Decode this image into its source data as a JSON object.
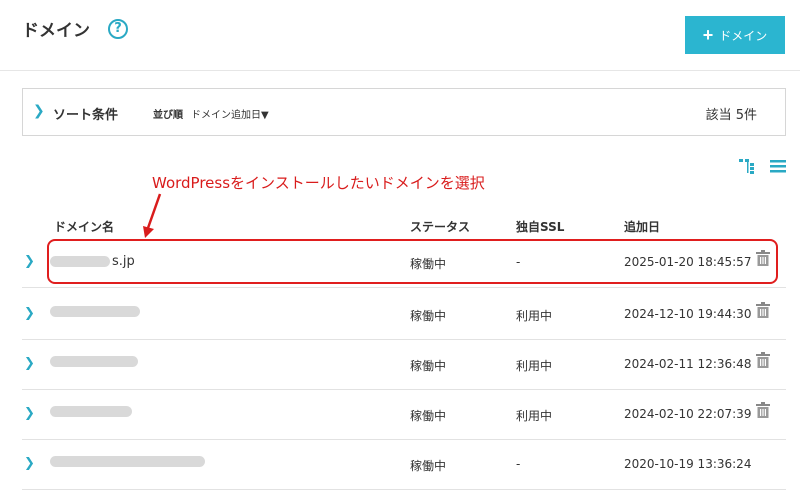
{
  "header": {
    "title": "ドメイン",
    "help_icon": "question-circle-icon",
    "add_button_label": "ドメイン",
    "accent_color": "#2bb5d0"
  },
  "sort": {
    "label": "ソート条件",
    "order_label": "並び順",
    "order_value": "ドメイン追加日▼",
    "count": "該当 5件"
  },
  "annotation": {
    "text": "WordPressをインストールしたいドメインを選択",
    "color": "#d91c1c"
  },
  "table": {
    "headers": {
      "domain": "ドメイン名",
      "status": "ステータス",
      "ssl": "独自SSL",
      "date": "追加日"
    },
    "rows": [
      {
        "domain_suffix": "s.jp",
        "status": "稼働中",
        "ssl": "-",
        "date": "2025-01-20 18:45:57"
      },
      {
        "domain_suffix": "",
        "status": "稼働中",
        "ssl": "利用中",
        "date": "2024-12-10 19:44:30"
      },
      {
        "domain_suffix": "",
        "status": "稼働中",
        "ssl": "利用中",
        "date": "2024-02-11 12:36:48"
      },
      {
        "domain_suffix": "",
        "status": "稼働中",
        "ssl": "利用中",
        "date": "2024-02-10 22:07:39"
      },
      {
        "domain_suffix": "",
        "status": "稼働中",
        "ssl": "-",
        "date": "2020-10-19 13:36:24"
      }
    ]
  }
}
